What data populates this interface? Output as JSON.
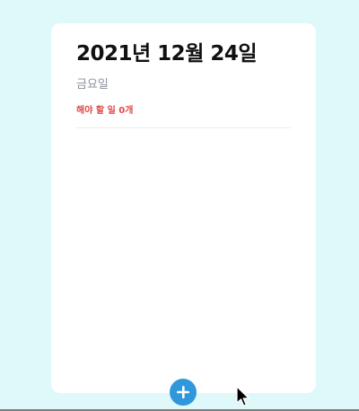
{
  "header": {
    "date_title": "2021년 12월 24일",
    "weekday": "금요일",
    "remaining_tasks": "해야 할 일 0개"
  },
  "todos": [],
  "colors": {
    "background": "#dff8fa",
    "card": "#ffffff",
    "accent": "#2f97dc",
    "remaining_text": "#e04a4a"
  },
  "icons": {
    "add": "plus-icon",
    "cursor": "mouse-pointer-icon"
  }
}
